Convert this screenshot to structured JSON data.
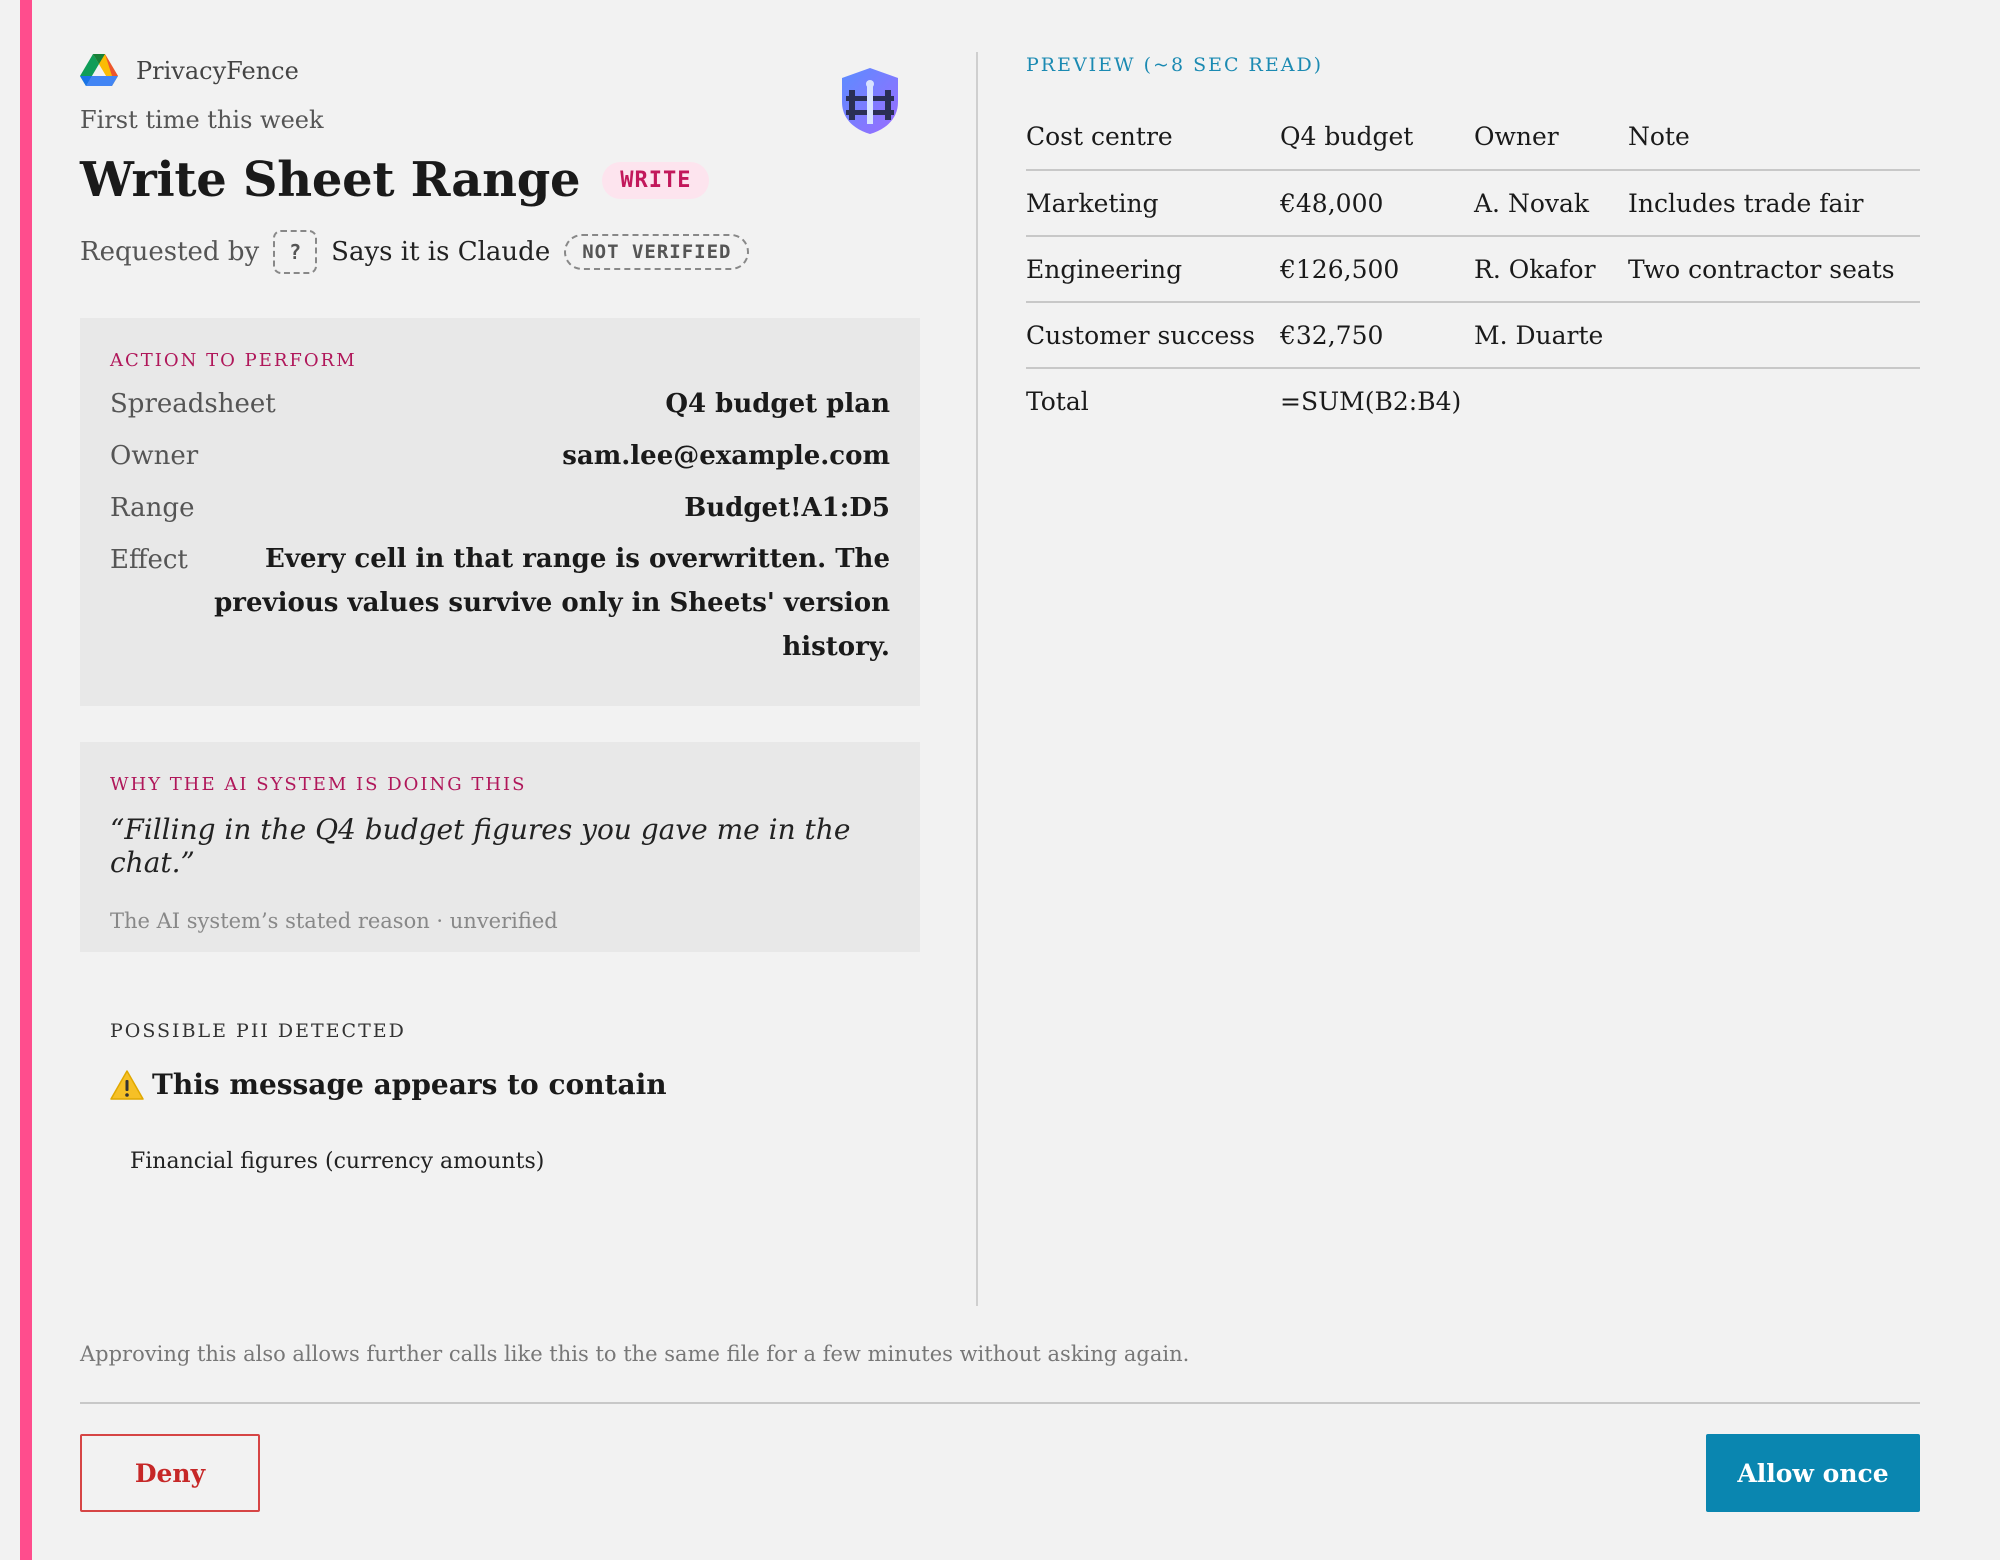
{
  "app": {
    "brand_name": "PrivacyFence",
    "brand_icon": "google-drive-icon",
    "shield_icon": "privacy-shield-icon",
    "first_time": "First time this week",
    "title": "Write Sheet Range",
    "badge": "WRITE",
    "requested_by_label": "Requested by",
    "requester_unknown_glyph": "?",
    "requester_claim": "Says it is Claude",
    "verification_badge": "NOT VERIFIED"
  },
  "action": {
    "label": "ACTION TO PERFORM",
    "rows": [
      {
        "key": "Spreadsheet",
        "value": "Q4 budget plan"
      },
      {
        "key": "Owner",
        "value": "sam.lee@example.com"
      },
      {
        "key": "Range",
        "value": "Budget!A1:D5"
      },
      {
        "key": "Effect",
        "value": "Every cell in that range is overwritten. The previous values survive only in Sheets' version history."
      }
    ]
  },
  "why": {
    "label": "WHY THE AI SYSTEM IS DOING THIS",
    "quote": "“Filling in the Q4 budget figures you gave me in the chat.”",
    "stated": "The AI system’s stated reason · unverified"
  },
  "pii": {
    "label": "POSSIBLE PII DETECTED",
    "icon": "warning-icon",
    "heading": "This message appears to contain",
    "items": [
      "Financial figures (currency amounts)"
    ]
  },
  "preview": {
    "label": "PREVIEW (~8 SEC READ)",
    "headers": [
      "Cost centre",
      "Q4 budget",
      "Owner",
      "Note"
    ],
    "rows": [
      [
        "Marketing",
        "€48,000",
        "A. Novak",
        "Includes trade fair"
      ],
      [
        "Engineering",
        "€126,500",
        "R. Okafor",
        "Two contractor seats"
      ],
      [
        "Customer success",
        "€32,750",
        "M. Duarte",
        ""
      ],
      [
        "Total",
        "=SUM(B2:B4)",
        "",
        ""
      ]
    ]
  },
  "footer": {
    "note": "Approving this also allows further calls like this to the same file for a few minutes without asking again.",
    "deny_label": "Deny",
    "allow_label": "Allow once"
  },
  "colors": {
    "accent": "#ff4d8d",
    "badge_text": "#c2185b",
    "preview_label": "#1b8ab2",
    "allow_button": "#0a86b0",
    "deny_button": "#c62828"
  }
}
